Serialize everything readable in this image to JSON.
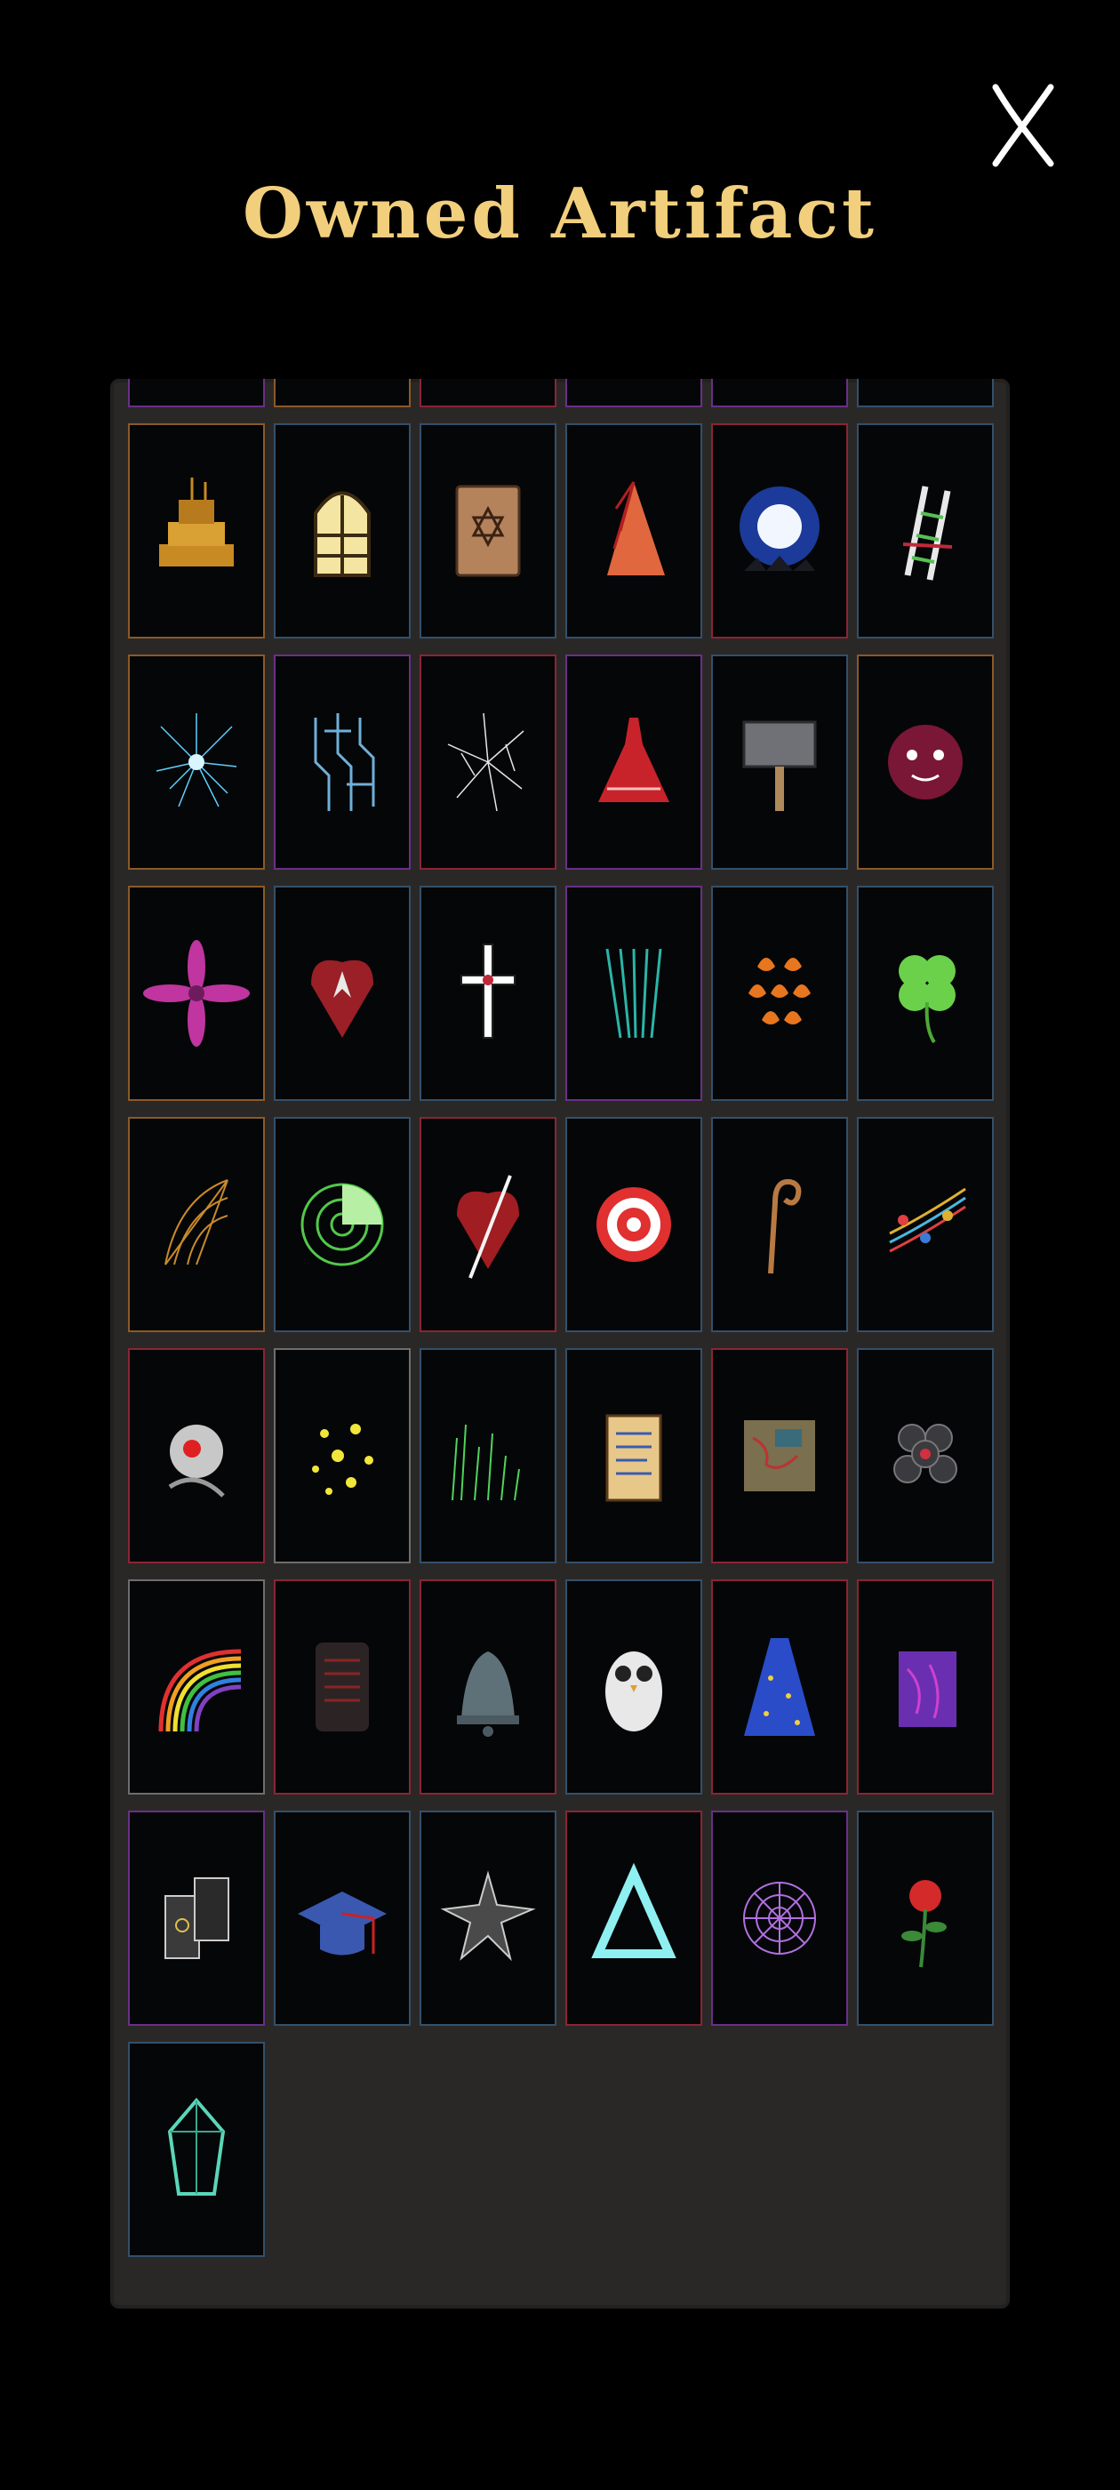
{
  "title": "Owned Artifact",
  "close_icon": "close-x-icon",
  "artifacts": [
    {
      "icon": "dark-eye-icon",
      "border": "purple"
    },
    {
      "icon": "flower-bouquet-icon",
      "border": "orange"
    },
    {
      "icon": "spiral-icon",
      "border": "red"
    },
    {
      "icon": "bat-icon",
      "border": "purple"
    },
    {
      "icon": "claw-icon",
      "border": "purple"
    },
    {
      "icon": "red-orb-icon",
      "border": "blue"
    },
    {
      "icon": "ghost-ship-icon",
      "border": "orange"
    },
    {
      "icon": "stained-window-icon",
      "border": "blue"
    },
    {
      "icon": "hexagram-tome-icon",
      "border": "blue"
    },
    {
      "icon": "red-wing-icon",
      "border": "blue"
    },
    {
      "icon": "full-moon-icon",
      "border": "red"
    },
    {
      "icon": "ladder-icon",
      "border": "blue"
    },
    {
      "icon": "cyan-burst-icon",
      "border": "orange"
    },
    {
      "icon": "circuit-icon",
      "border": "purple"
    },
    {
      "icon": "shatter-icon",
      "border": "red"
    },
    {
      "icon": "red-dress-icon",
      "border": "purple"
    },
    {
      "icon": "hammer-icon",
      "border": "blue"
    },
    {
      "icon": "blood-face-icon",
      "border": "orange"
    },
    {
      "icon": "magenta-flower-icon",
      "border": "orange"
    },
    {
      "icon": "demon-heart-icon",
      "border": "blue"
    },
    {
      "icon": "holy-cross-icon",
      "border": "blue"
    },
    {
      "icon": "teal-rays-icon",
      "border": "purple"
    },
    {
      "icon": "flame-scales-icon",
      "border": "blue"
    },
    {
      "icon": "four-leaf-clover-icon",
      "border": "blue"
    },
    {
      "icon": "golden-web-icon",
      "border": "orange"
    },
    {
      "icon": "radar-icon",
      "border": "blue"
    },
    {
      "icon": "pierced-heart-icon",
      "border": "red"
    },
    {
      "icon": "target-icon",
      "border": "blue"
    },
    {
      "icon": "shepherd-staff-icon",
      "border": "blue"
    },
    {
      "icon": "music-notes-icon",
      "border": "blue"
    },
    {
      "icon": "red-eye-machine-icon",
      "border": "red"
    },
    {
      "icon": "yellow-sparks-icon",
      "border": "gray"
    },
    {
      "icon": "aurora-icon",
      "border": "blue"
    },
    {
      "icon": "scroll-icon",
      "border": "blue"
    },
    {
      "icon": "treasure-map-icon",
      "border": "red"
    },
    {
      "icon": "dark-cluster-icon",
      "border": "blue"
    },
    {
      "icon": "rainbow-icon",
      "border": "gray"
    },
    {
      "icon": "stone-tablet-icon",
      "border": "red"
    },
    {
      "icon": "bell-icon",
      "border": "red"
    },
    {
      "icon": "owl-icon",
      "border": "blue"
    },
    {
      "icon": "wizard-cloak-icon",
      "border": "red"
    },
    {
      "icon": "purple-banner-icon",
      "border": "red"
    },
    {
      "icon": "tarot-cards-icon",
      "border": "purple"
    },
    {
      "icon": "graduation-cap-icon",
      "border": "blue"
    },
    {
      "icon": "spiked-star-icon",
      "border": "blue"
    },
    {
      "icon": "triangle-icon",
      "border": "red"
    },
    {
      "icon": "spider-web-icon",
      "border": "purple"
    },
    {
      "icon": "rose-icon",
      "border": "blue"
    },
    {
      "icon": "crystal-icon",
      "border": "blue"
    }
  ]
}
